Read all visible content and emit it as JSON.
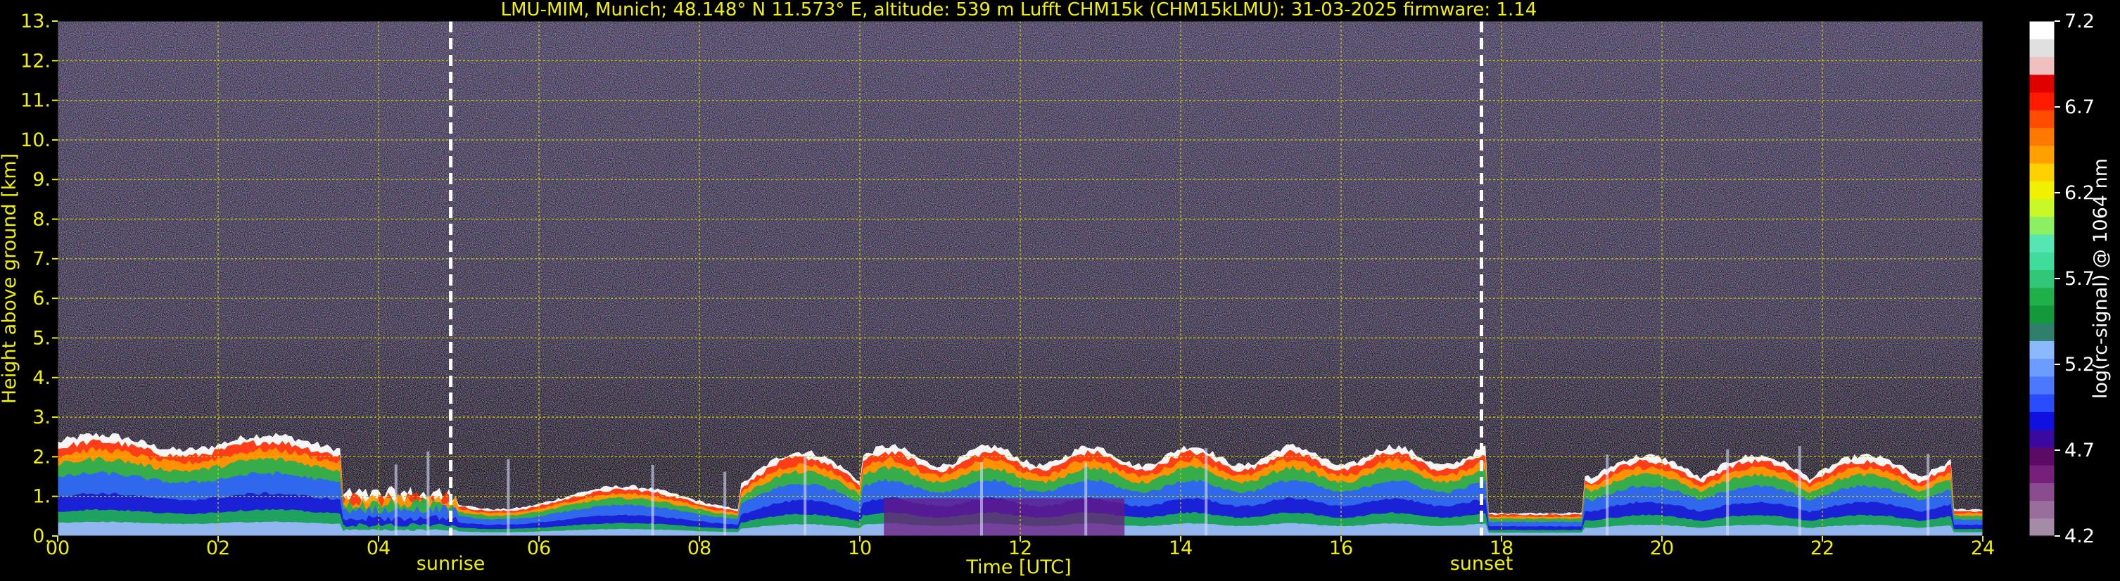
{
  "chart_data": {
    "type": "heatmap",
    "title": "LMU-MIM, Munich; 48.148° N 11.573° E, altitude: 539 m    Lufft CHM15k (CHM15kLMU): 31-03-2025    firmware: 1.14",
    "xlabel": "Time [UTC]",
    "ylabel": "Height above ground [km]",
    "xlim": [
      0,
      24
    ],
    "ylim": [
      0,
      13
    ],
    "x_tick_values": [
      0,
      2,
      4,
      6,
      8,
      10,
      12,
      14,
      16,
      18,
      20,
      22,
      24
    ],
    "x_tick_labels": [
      "00",
      "02",
      "04",
      "06",
      "08",
      "10",
      "12",
      "14",
      "16",
      "18",
      "20",
      "22",
      "24"
    ],
    "y_tick_values": [
      0,
      1,
      2,
      3,
      4,
      5,
      6,
      7,
      8,
      9,
      10,
      11,
      12,
      13
    ],
    "y_tick_labels": [
      "0.",
      "1.",
      "2.",
      "3.",
      "4.",
      "5.",
      "6.",
      "7.",
      "8.",
      "9.",
      "10.",
      "11.",
      "12.",
      "13."
    ],
    "grid": true,
    "events": [
      {
        "label": "sunrise",
        "time": 4.9
      },
      {
        "label": "sunset",
        "time": 17.75
      }
    ],
    "colorbar": {
      "label": "log(rc-signal) @ 1064 nm",
      "min": 4.2,
      "max": 7.2,
      "tick_values": [
        4.2,
        4.7,
        5.2,
        5.7,
        6.2,
        6.7,
        7.2
      ],
      "tick_labels": [
        "4.2",
        "4.7",
        "5.2",
        "5.7",
        "6.2",
        "6.7",
        "7.2"
      ],
      "colors": [
        "#a48ca6",
        "#9a6e9c",
        "#8a4c8e",
        "#761f7b",
        "#5c0a66",
        "#3a0aa0",
        "#1010e0",
        "#2a4cff",
        "#4a78ff",
        "#6c9cff",
        "#8cb8ff",
        "#2f7f6c",
        "#129a3a",
        "#20b04a",
        "#30c878",
        "#40dc9c",
        "#56e6b4",
        "#8cf060",
        "#c8f828",
        "#f0f000",
        "#ffd000",
        "#ffa000",
        "#ff7800",
        "#ff4c00",
        "#ff1a00",
        "#e00000",
        "#f0c0c0",
        "#e0e0e0",
        "#ffffff"
      ]
    }
  },
  "colors": {
    "background": "#000000",
    "axis_text": "#f0f000",
    "grid": "#c8c800",
    "event_line": "#ffffff"
  }
}
